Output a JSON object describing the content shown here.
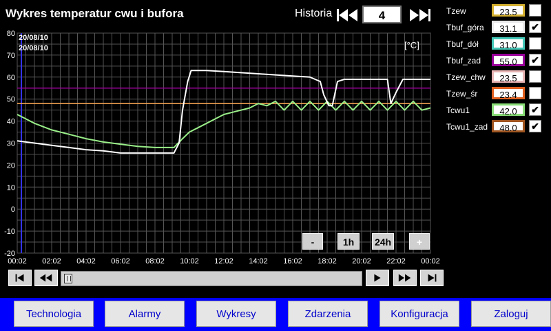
{
  "header": {
    "title": "Wykres temperatur cwu i bufora",
    "history_label": "Historia",
    "history_value": "4"
  },
  "chart": {
    "dates": [
      "20/08/10",
      "20/08/10"
    ],
    "unit_label": "[°C]",
    "y_ticks": [
      "80",
      "70",
      "60",
      "50",
      "40",
      "30",
      "20",
      "10",
      "0",
      "-10",
      "-20"
    ],
    "x_ticks": [
      "00:02",
      "02:02",
      "04:02",
      "06:02",
      "08:02",
      "10:02",
      "12:02",
      "14:02",
      "16:02",
      "18:02",
      "20:02",
      "22:02",
      "00:02"
    ],
    "zoom_buttons": [
      "-",
      "1h",
      "24h",
      "+"
    ],
    "colors": {
      "tbuf_gora": "#ffffff",
      "tcwu1": "#99ee88",
      "tbuf_zad": "#990099",
      "tcwu1_zad": "#ffaa55",
      "cursor": "#3333ff",
      "grid": "#555555"
    }
  },
  "chart_data": {
    "type": "line",
    "ylim": [
      -20,
      80
    ],
    "x_unit": "hours since 00:02",
    "xlim": [
      0,
      24
    ],
    "series": [
      {
        "name": "Tbuf_góra",
        "x": [
          0,
          1,
          2,
          3,
          4,
          5,
          6,
          7,
          8,
          9.1,
          9.4,
          9.6,
          9.9,
          10.1,
          11,
          12,
          13,
          14,
          15,
          16,
          17,
          17.3,
          17.6,
          17.8,
          18.1,
          18.3,
          18.6,
          19,
          20,
          21,
          21.5,
          21.7,
          22,
          22.4,
          24
        ],
        "y": [
          31,
          30,
          29,
          28,
          27,
          26.5,
          25.5,
          25.5,
          25.5,
          25.5,
          30,
          45,
          58,
          63,
          63,
          62.5,
          62,
          61.5,
          61,
          60.5,
          60,
          59,
          58,
          52,
          47,
          47,
          58,
          59,
          59,
          59,
          59,
          48,
          53,
          59,
          59
        ]
      },
      {
        "name": "Tcwu1",
        "x": [
          0,
          0.5,
          1,
          2,
          3,
          4,
          5,
          6,
          7,
          8,
          9.1,
          9.6,
          10,
          10.5,
          11,
          11.5,
          12,
          12.5,
          13,
          13.5,
          14,
          14.5,
          15,
          15.5,
          16,
          16.5,
          17,
          17.5,
          18,
          18.5,
          19,
          19.5,
          20,
          20.5,
          21,
          21.5,
          22,
          22.5,
          23,
          23.5,
          24
        ],
        "y": [
          43,
          41,
          39,
          36,
          34,
          32,
          30.5,
          29.5,
          28.5,
          28,
          28,
          32,
          35,
          37,
          39,
          41,
          43,
          44,
          45,
          46,
          48,
          47,
          49,
          45,
          49,
          45,
          49,
          45,
          49,
          45,
          49,
          45,
          49,
          45,
          49,
          45,
          49,
          45,
          49,
          45,
          46
        ]
      },
      {
        "name": "Tbuf_zad",
        "x": [
          0,
          24
        ],
        "y": [
          55,
          55
        ]
      },
      {
        "name": "Tcwu1_zad",
        "x": [
          0,
          24
        ],
        "y": [
          48,
          48
        ]
      }
    ]
  },
  "legend": [
    {
      "label": "Tzew",
      "value": "23.5",
      "border": "#d4b030",
      "checked": false
    },
    {
      "label": "Tbuf_góra",
      "value": "31.1",
      "border": "#e8e8e8",
      "checked": true
    },
    {
      "label": "Tbuf_dół",
      "value": "31.0",
      "border": "#44c8b8",
      "checked": false
    },
    {
      "label": "Tbuf_zad",
      "value": "55.0",
      "border": "#990099",
      "checked": true
    },
    {
      "label": "Tzew_chw",
      "value": "23.5",
      "border": "#e8b4b4",
      "checked": false
    },
    {
      "label": "Tzew_śr",
      "value": "23.4",
      "border": "#e06020",
      "checked": false
    },
    {
      "label": "Tcwu1",
      "value": "42.0",
      "border": "#88dd77",
      "checked": true
    },
    {
      "label": "Tcwu1_zad",
      "value": "48.0",
      "border": "#a05520",
      "checked": true
    }
  ],
  "check_mark": "✔",
  "footer": {
    "tabs": [
      "Technologia",
      "Alarmy",
      "Wykresy",
      "Zdarzenia",
      "Konfiguracja",
      "Zaloguj"
    ]
  }
}
